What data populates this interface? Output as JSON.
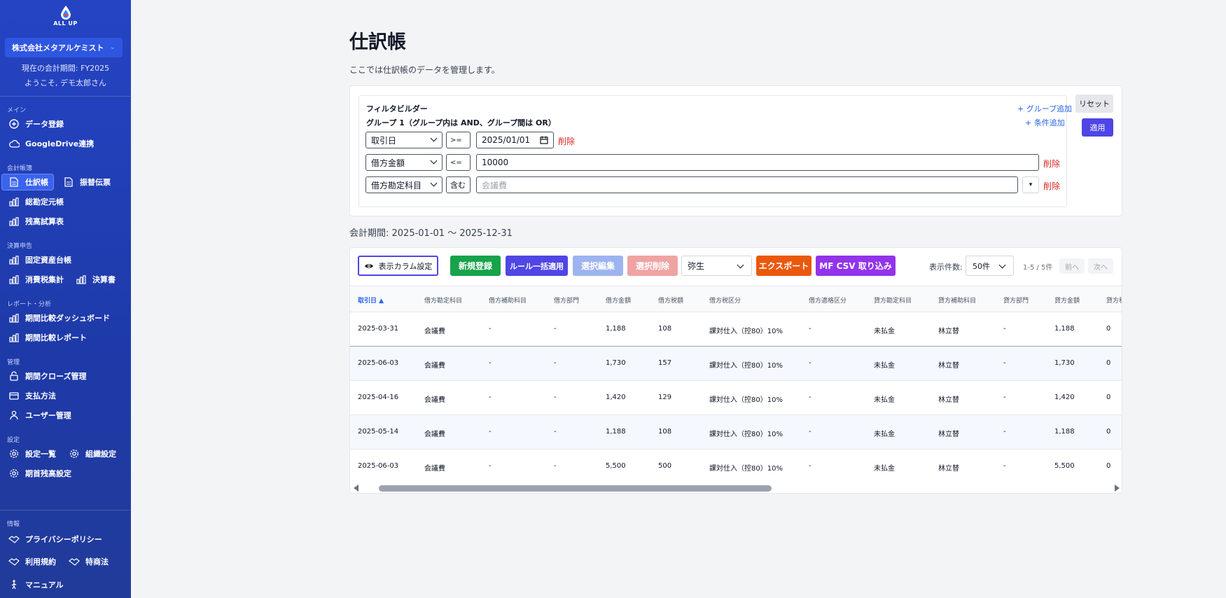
{
  "brand": {
    "logo_text": "ALL UP"
  },
  "sidebar": {
    "company": "株式会社メタアルケミスト",
    "period": "現在の会計期間: FY2025",
    "welcome": "ようこそ, デモ太郎さん",
    "sections": {
      "main": "メイン",
      "books": "会計帳簿",
      "closing": "決算申告",
      "reports": "レポート・分析",
      "admin": "管理",
      "settings": "設定",
      "info": "情報"
    },
    "items": {
      "data_entry": "データ登録",
      "gdrive": "GoogleDrive連携",
      "journal": "仕訳帳",
      "transfer_slip": "振替伝票",
      "general_ledger": "総勘定元帳",
      "trial_balance": "残高試算表",
      "fixed_assets": "固定資産台帳",
      "consumption_tax": "消費税集計",
      "financial_statements": "決算書",
      "compare_dashboard": "期間比較ダッシュボード",
      "compare_report": "期間比較レポート",
      "period_close": "期間クローズ管理",
      "payment_methods": "支払方法",
      "user_admin": "ユーザー管理",
      "settings_list": "設定一覧",
      "org_settings": "組織設定",
      "opening_balance": "期首残高設定",
      "privacy": "プライバシーポリシー",
      "terms": "利用規約",
      "tokushoho": "特商法",
      "manual": "マニュアル"
    }
  },
  "page": {
    "title": "仕訳帳",
    "description": "ここでは仕訳帳のデータを管理します。",
    "accounting_period": "会計期間: 2025-01-01 〜 2025-12-31"
  },
  "filter": {
    "title": "フィルタビルダー",
    "group_label": "グループ 1（グループ内は AND、グループ間は OR）",
    "add_group": "+ グループ追加",
    "add_condition": "+ 条件追加",
    "delete_label": "削除",
    "reset": "リセット",
    "apply": "適用",
    "conditions": [
      {
        "field": "取引日",
        "op": ">=",
        "value": "2025/01/01"
      },
      {
        "field": "借方金額",
        "op": "<=",
        "value": "10000"
      },
      {
        "field": "借方勘定科目",
        "op": "含む",
        "value": "",
        "placeholder": "会議費"
      }
    ]
  },
  "toolbar": {
    "columns_button": "表示カラム設定",
    "new": "新規登録",
    "rule_apply": "ルール一括適用",
    "bulk_edit": "選択編集",
    "bulk_delete": "選択削除",
    "vendor": "弥生",
    "export": "エクスポート",
    "mf_import": "MF CSV 取り込み",
    "per_page_label": "表示件数:",
    "per_page": "50件",
    "page_info": "1-5 / 5件",
    "prev": "前へ",
    "next": "次へ"
  },
  "colors": {
    "new": "#16a34a",
    "rule_apply": "#4f46e5",
    "bulk_edit": "#9db4f0",
    "bulk_delete": "#f0a3a3",
    "export": "#ea580c",
    "mf_import": "#9333ea"
  },
  "table": {
    "headers": [
      "取引日 ▲",
      "借方勘定科目",
      "借方補助科目",
      "借方部門",
      "借方金額",
      "借方税額",
      "借方税区分",
      "借方適格区分",
      "貸方勘定科目",
      "貸方補助科目",
      "貸方部門",
      "貸方金額",
      "貸方税額"
    ],
    "rows": [
      [
        "2025-03-31",
        "会議費",
        "-",
        "-",
        "1,188",
        "108",
        "課対仕入（控80）10%",
        "-",
        "未払金",
        "林立替",
        "-",
        "1,188",
        "0"
      ],
      [
        "2025-06-03",
        "会議費",
        "-",
        "-",
        "1,730",
        "157",
        "課対仕入（控80）10%",
        "-",
        "未払金",
        "林立替",
        "-",
        "1,730",
        "0"
      ],
      [
        "2025-04-16",
        "会議費",
        "-",
        "-",
        "1,420",
        "129",
        "課対仕入（控80）10%",
        "-",
        "未払金",
        "林立替",
        "-",
        "1,420",
        "0"
      ],
      [
        "2025-05-14",
        "会議費",
        "-",
        "-",
        "1,188",
        "108",
        "課対仕入（控80）10%",
        "-",
        "未払金",
        "林立替",
        "-",
        "1,188",
        "0"
      ],
      [
        "2025-06-03",
        "会議費",
        "-",
        "-",
        "5,500",
        "500",
        "課対仕入（控80）10%",
        "-",
        "未払金",
        "林立替",
        "-",
        "5,500",
        "0"
      ]
    ]
  }
}
